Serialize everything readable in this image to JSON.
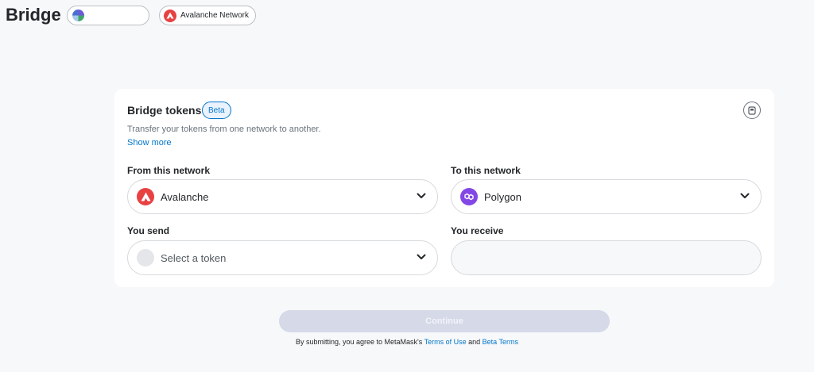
{
  "header": {
    "title": "Bridge",
    "network_label": "Avalanche Network"
  },
  "card": {
    "title": "Bridge tokens",
    "badge": "Beta",
    "description": "Transfer your tokens from one network to another.",
    "show_more": "Show more"
  },
  "from": {
    "label": "From this network",
    "network": "Avalanche"
  },
  "to": {
    "label": "To this network",
    "network": "Polygon"
  },
  "send": {
    "label": "You send",
    "placeholder": "Select a token"
  },
  "receive": {
    "label": "You receive",
    "value": ""
  },
  "actions": {
    "continue_label": "Continue"
  },
  "terms": {
    "prefix": "By submitting, you agree to MetaMask's",
    "terms_link": "Terms of Use",
    "and": "and",
    "beta_link": "Beta Terms"
  },
  "colors": {
    "accent": "#0376c9",
    "avalanche": "#e84142",
    "polygon": "#8247e5",
    "disabled_button": "#d5d9e8"
  },
  "icons": {
    "account": "account-avatar-icon",
    "avalanche": "avalanche-icon",
    "polygon": "polygon-icon",
    "chevron": "chevron-down-icon",
    "card_action": "bookmark-icon"
  }
}
